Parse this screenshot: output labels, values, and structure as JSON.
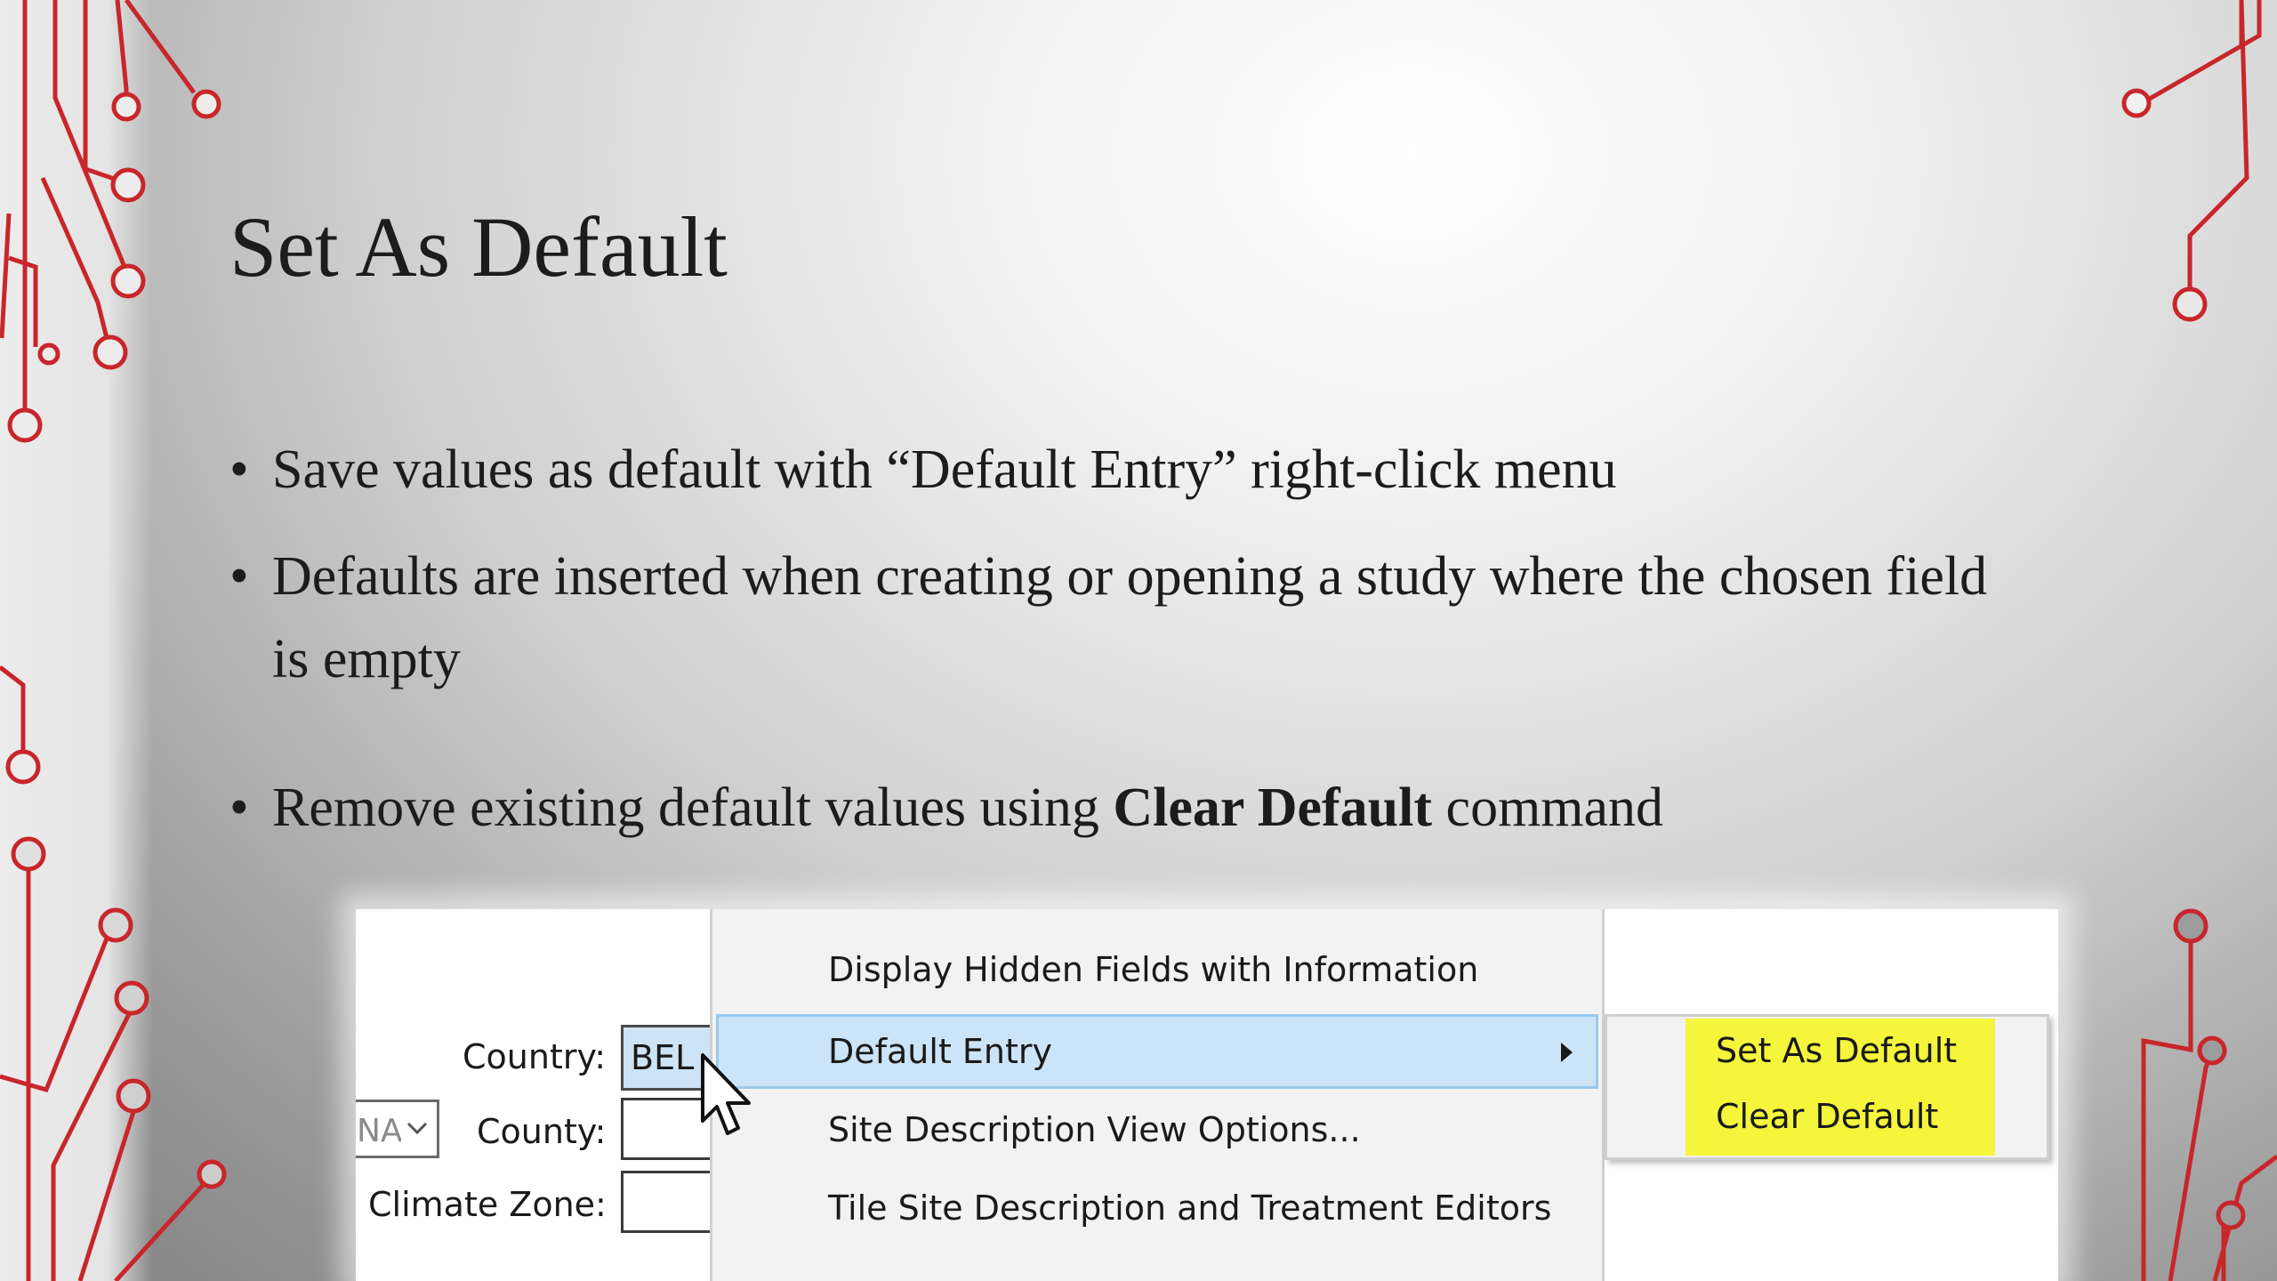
{
  "slide": {
    "title": "Set As Default",
    "bullet_char": "•",
    "bullets": [
      "Save values as default with “Default Entry” right-click menu",
      "Defaults are inserted when creating or opening a study where the chosen field is empty"
    ],
    "bullet3": {
      "pre": "Remove existing default values using ",
      "bold": "Clear Default",
      "post": " command"
    }
  },
  "form": {
    "country_label": "Country:",
    "country_value": "BEL",
    "county_label": "County:",
    "dropdown_value": "NA",
    "climate_label": "Climate Zone:"
  },
  "context_menu": {
    "items": [
      "Display Hidden Fields with Information",
      "Default Entry",
      "Site Description View Options...",
      "Tile Site Description and Treatment Editors"
    ],
    "highlighted": "Default Entry"
  },
  "submenu": {
    "items": [
      "Set As Default",
      "Clear Default"
    ]
  },
  "icons": {
    "cursor": "arrow-cursor-icon",
    "submenu_arrow": "triangle-right-icon",
    "dropdown": "chevron-down-icon"
  },
  "colors": {
    "circuit": "#c8262b",
    "menu_highlight": "#cce4f7",
    "submenu_highlight": "#f5f53c"
  }
}
